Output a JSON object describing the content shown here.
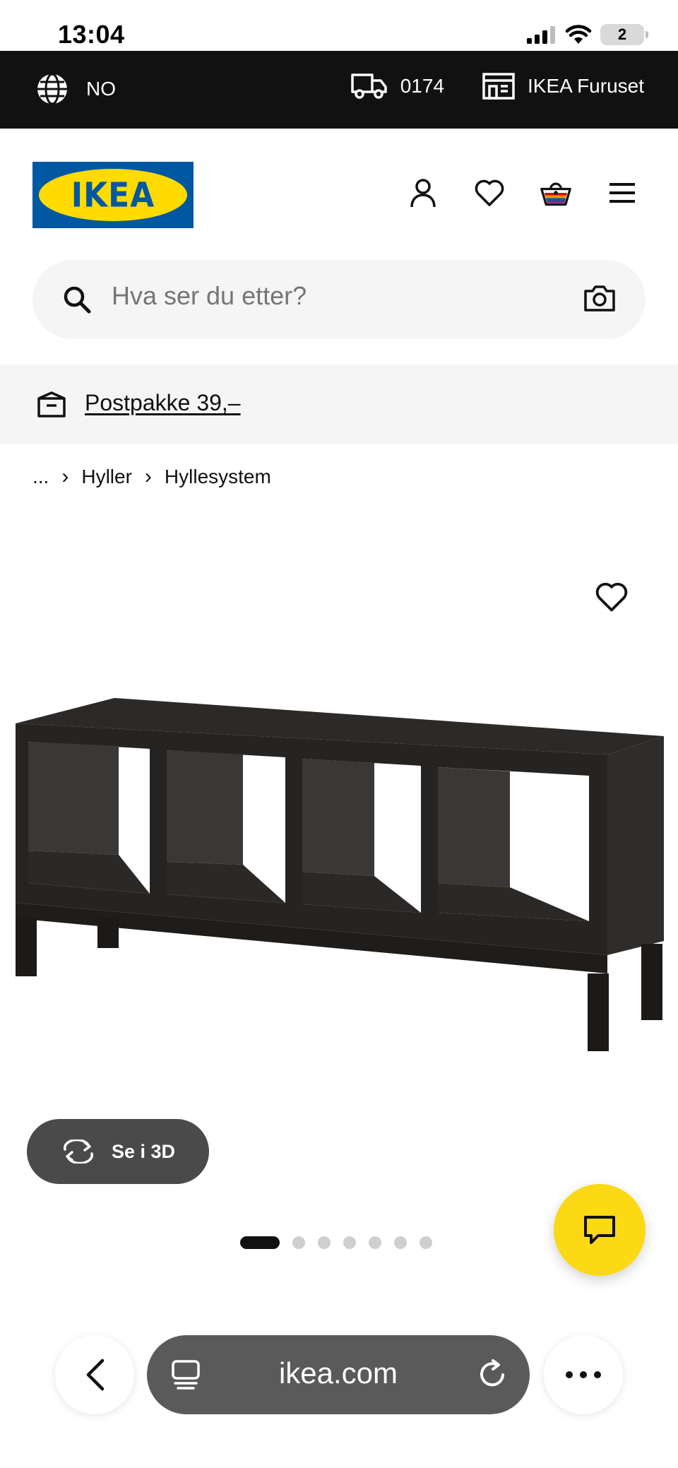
{
  "status_bar": {
    "time": "13:04",
    "battery": "2"
  },
  "top_bar": {
    "language": "NO",
    "postcode": "0174",
    "store": "IKEA Furuset"
  },
  "header": {
    "logo_text": "IKEA"
  },
  "search": {
    "placeholder": "Hva ser du etter?"
  },
  "promo": {
    "text": "Postpakke 39,–"
  },
  "breadcrumb": {
    "ellipsis": "...",
    "items": [
      "Hyller",
      "Hyllesystem"
    ]
  },
  "product": {
    "btn_3d_label": "Se i 3D",
    "gallery_count": 7,
    "gallery_active": 0
  },
  "browser": {
    "url": "ikea.com"
  },
  "colors": {
    "brand_blue": "#0058a3",
    "brand_yellow": "#ffdb00",
    "top_bar": "#111111",
    "chat_button": "#fbd914"
  },
  "icons": [
    "globe-icon",
    "truck-icon",
    "store-icon",
    "profile-icon",
    "heart-icon",
    "basket-icon",
    "menu-icon",
    "search-icon",
    "camera-icon",
    "parcel-icon",
    "rotate-3d-icon",
    "chat-icon",
    "back-icon",
    "tabs-icon",
    "reload-icon",
    "more-icon"
  ]
}
